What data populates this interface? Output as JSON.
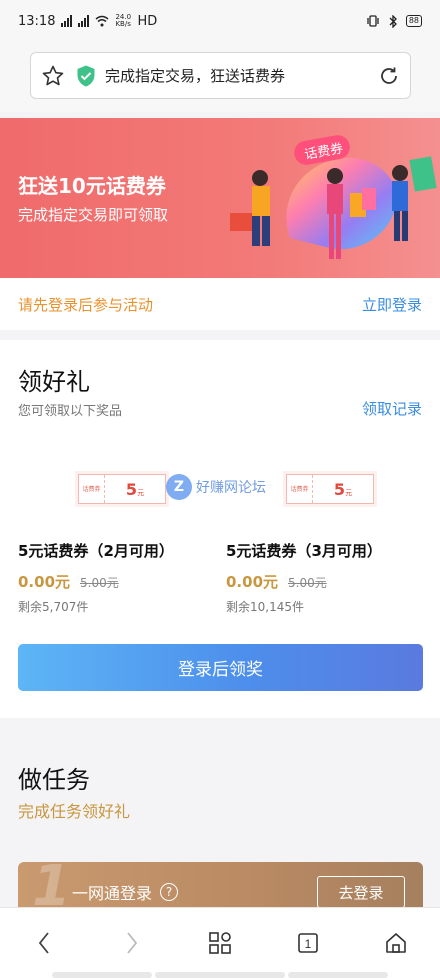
{
  "status_bar": {
    "time": "13:18",
    "network": "HD",
    "speed": "24.0\nKB/s",
    "battery": "88"
  },
  "address_bar": {
    "title": "完成指定交易，狂送话费券",
    "icons": [
      "star-icon",
      "shield-check-icon",
      "reload-icon"
    ]
  },
  "banner": {
    "headline": "狂送10元话费券",
    "subline": "完成指定交易即可领取",
    "badge": "话费券"
  },
  "login_strip": {
    "prompt": "请先登录后参与活动",
    "link": "立即登录"
  },
  "gift_section": {
    "title": "领好礼",
    "subtitle": "您可领取以下奖品",
    "record_link": "领取记录",
    "watermark": "好赚网论坛",
    "vouchers": [
      {
        "tag": "话费券",
        "amount": "5",
        "unit": "元"
      },
      {
        "tag": "话费券",
        "amount": "5",
        "unit": "元"
      }
    ],
    "prizes": [
      {
        "name": "5元话费券（2月可用）",
        "price": "0.00元",
        "original": "5.00元",
        "stock": "剩余5,707件"
      },
      {
        "name": "5元话费券（3月可用）",
        "price": "0.00元",
        "original": "5.00元",
        "stock": "剩余10,145件"
      }
    ],
    "claim_button": "登录后领奖"
  },
  "task_section": {
    "title": "做任务",
    "subtitle": "完成任务领好礼",
    "tasks": [
      {
        "index": "1",
        "name": "一网通登录",
        "action": "去登录"
      }
    ]
  },
  "bottom_nav": {
    "items": [
      "back-icon",
      "forward-icon",
      "apps-icon",
      "tabs-icon",
      "home-icon"
    ],
    "tab_count": "1"
  },
  "colors": {
    "banner": "#f06b6b",
    "accent_orange": "#e8922e",
    "link_blue": "#3b8de0",
    "gold": "#c9973f",
    "button_blue": "#4d8fec"
  }
}
